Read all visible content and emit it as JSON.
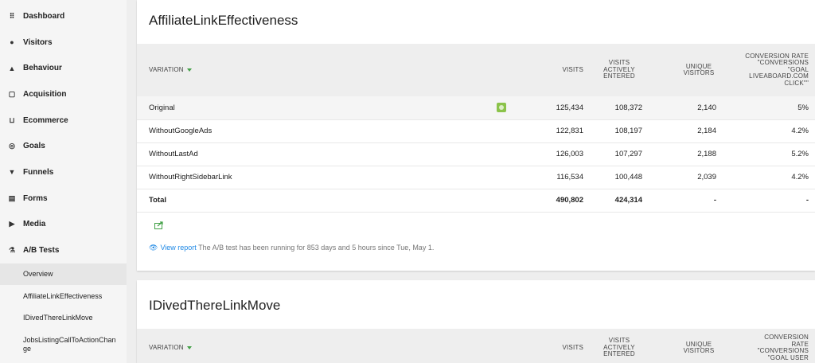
{
  "sidebar": {
    "items": [
      {
        "label": "Dashboard",
        "icon": "grid-icon",
        "glyph": "⠿"
      },
      {
        "label": "Visitors",
        "icon": "binoculars-icon",
        "glyph": "●"
      },
      {
        "label": "Behaviour",
        "icon": "bell-icon",
        "glyph": "▲"
      },
      {
        "label": "Acquisition",
        "icon": "window-icon",
        "glyph": "▢"
      },
      {
        "label": "Ecommerce",
        "icon": "cart-icon",
        "glyph": "⊔"
      },
      {
        "label": "Goals",
        "icon": "target-icon",
        "glyph": "◎"
      },
      {
        "label": "Funnels",
        "icon": "funnel-icon",
        "glyph": "▼"
      },
      {
        "label": "Forms",
        "icon": "form-icon",
        "glyph": "▤"
      },
      {
        "label": "Media",
        "icon": "media-icon",
        "glyph": "▶"
      },
      {
        "label": "A/B Tests",
        "icon": "flask-icon",
        "glyph": "⚗"
      }
    ],
    "subitems": [
      {
        "label": "Overview",
        "active": true
      },
      {
        "label": "AffiliateLinkEffectiveness"
      },
      {
        "label": "IDivedThereLinkMove"
      },
      {
        "label": "JobsListingCallToActionChange"
      }
    ]
  },
  "test1": {
    "title": "AffiliateLinkEffectiveness",
    "columns": {
      "variation": "VARIATION",
      "visits": "VISITS",
      "entered": "VISITS ACTIVELY ENTERED",
      "unique": "UNIQUE VISITORS",
      "conversion": "CONVERSION RATE \"CONVERSIONS \"GOAL LIVEABOARD.COM CLICK\"\""
    },
    "rows": [
      {
        "name": "Original",
        "visits": "125,434",
        "entered": "108,372",
        "unique": "2,140",
        "rate": "5%"
      },
      {
        "name": "WithoutGoogleAds",
        "visits": "122,831",
        "entered": "108,197",
        "unique": "2,184",
        "rate": "4.2%"
      },
      {
        "name": "WithoutLastAd",
        "visits": "126,003",
        "entered": "107,297",
        "unique": "2,188",
        "rate": "5.2%"
      },
      {
        "name": "WithoutRightSidebarLink",
        "visits": "116,534",
        "entered": "100,448",
        "unique": "2,039",
        "rate": "4.2%"
      }
    ],
    "total": {
      "name": "Total",
      "visits": "490,802",
      "entered": "424,314",
      "unique": "-",
      "rate": "-"
    },
    "view_report": "View report",
    "note": "The A/B test has been running for 853 days and 5 hours since Tue, May 1."
  },
  "test2": {
    "title": "IDivedThereLinkMove",
    "columns": {
      "variation": "VARIATION",
      "visits": "VISITS",
      "entered": "VISITS ACTIVELY ENTERED",
      "unique": "UNIQUE VISITORS",
      "conversion": "CONVERSION RATE \"CONVERSIONS \"GOAL USER"
    }
  },
  "colors": {
    "accent_green": "#43a047",
    "link_blue": "#1e88e5"
  }
}
